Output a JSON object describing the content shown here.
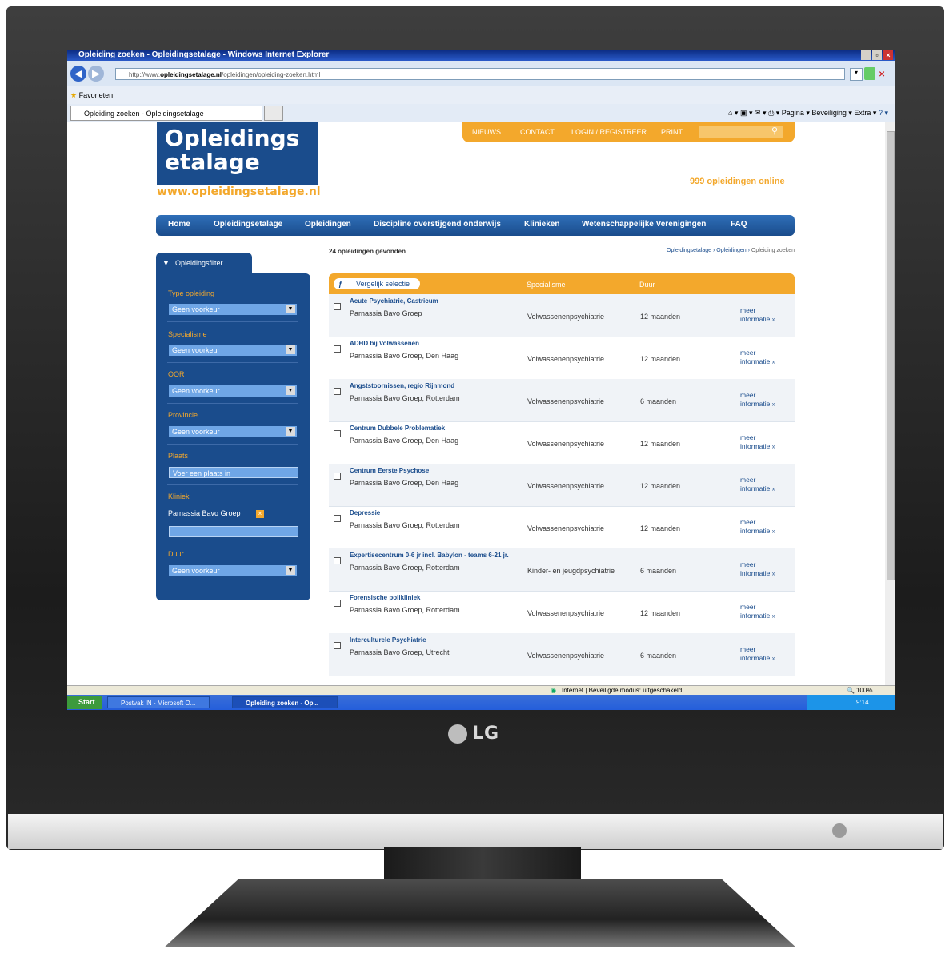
{
  "window": {
    "title": "Opleiding zoeken - Opleidingsetalage - Windows Internet Explorer",
    "url_prefix": "http://www.",
    "url_domain": "opleidingsetalage.nl",
    "url_path": "/opleidingen/opleiding-zoeken.html",
    "favorites": "Favorieten",
    "tab_title": "Opleiding zoeken - Opleidingsetalage",
    "cmd_items": [
      "Pagina ▾",
      "Beveiliging ▾",
      "Extra ▾"
    ]
  },
  "site": {
    "logo_line1": "Opleidings",
    "logo_line2": "etalage",
    "logo_url": "www.opleidingsetalage.nl",
    "topnav": [
      "NIEUWS",
      "CONTACT",
      "LOGIN / REGISTREER",
      "PRINT"
    ],
    "online_count": "999 opleidingen online",
    "mainnav": [
      "Home",
      "Opleidingsetalage",
      "Opleidingen",
      "Discipline overstijgend onderwijs",
      "Klinieken",
      "Wetenschappelijke Verenigingen",
      "FAQ"
    ]
  },
  "results_count": "24 opleidingen gevonden",
  "breadcrumb": {
    "item1": "Opleidingsetalage",
    "item2": "Opleidingen",
    "current": "Opleiding zoeken"
  },
  "filter": {
    "title": "Opleidingsfilter",
    "type_label": "Type opleiding",
    "type_value": "Geen voorkeur",
    "specialisme_label": "Specialisme",
    "specialisme_value": "Geen voorkeur",
    "oor_label": "OOR",
    "oor_value": "Geen voorkeur",
    "provincie_label": "Provincie",
    "provincie_value": "Geen voorkeur",
    "plaats_label": "Plaats",
    "plaats_placeholder": "Voer een plaats in",
    "kliniek_label": "Kliniek",
    "kliniek_value": "Parnassia Bavo Groep",
    "duur_label": "Duur",
    "duur_value": "Geen voorkeur"
  },
  "table": {
    "compare_label": "Vergelijk selectie",
    "col_specialisme": "Specialisme",
    "col_duur": "Duur",
    "more_line1": "meer",
    "more_line2": "informatie »",
    "rows": [
      {
        "title": "Acute Psychiatrie, Castricum",
        "sub": "Parnassia Bavo Groep",
        "specialisme": "Volwassenenpsychiatrie",
        "duur": "12 maanden"
      },
      {
        "title": "ADHD bij Volwassenen",
        "sub": "Parnassia Bavo Groep, Den Haag",
        "specialisme": "Volwassenenpsychiatrie",
        "duur": "12 maanden"
      },
      {
        "title": "Angststoornissen, regio Rijnmond",
        "sub": "Parnassia Bavo Groep, Rotterdam",
        "specialisme": "Volwassenenpsychiatrie",
        "duur": "6 maanden"
      },
      {
        "title": "Centrum Dubbele Problematiek",
        "sub": "Parnassia Bavo Groep, Den Haag",
        "specialisme": "Volwassenenpsychiatrie",
        "duur": "12 maanden"
      },
      {
        "title": "Centrum Eerste Psychose",
        "sub": "Parnassia Bavo Groep, Den Haag",
        "specialisme": "Volwassenenpsychiatrie",
        "duur": "12 maanden"
      },
      {
        "title": "Depressie",
        "sub": "Parnassia Bavo Groep, Rotterdam",
        "specialisme": "Volwassenenpsychiatrie",
        "duur": "12 maanden"
      },
      {
        "title": "Expertisecentrum 0-6 jr incl. Babylon - teams 6-21 jr.",
        "sub": "Parnassia Bavo Groep, Rotterdam",
        "specialisme": "Kinder- en jeugdpsychiatrie",
        "duur": "6 maanden"
      },
      {
        "title": "Forensische polikliniek",
        "sub": "Parnassia Bavo Groep, Rotterdam",
        "specialisme": "Volwassenenpsychiatrie",
        "duur": "12 maanden"
      },
      {
        "title": "Interculturele Psychiatrie",
        "sub": "Parnassia Bavo Groep, Utrecht",
        "specialisme": "Volwassenenpsychiatrie",
        "duur": "6 maanden"
      }
    ]
  },
  "statusbar": {
    "zone": "Internet | Beveiligde modus: uitgeschakeld",
    "zoom": "100%"
  },
  "taskbar": {
    "start": "Start",
    "item1": "Postvak IN - Microsoft O...",
    "item2": "Opleiding zoeken - Op...",
    "clock": "9:14"
  },
  "monitor_brand": "LG"
}
